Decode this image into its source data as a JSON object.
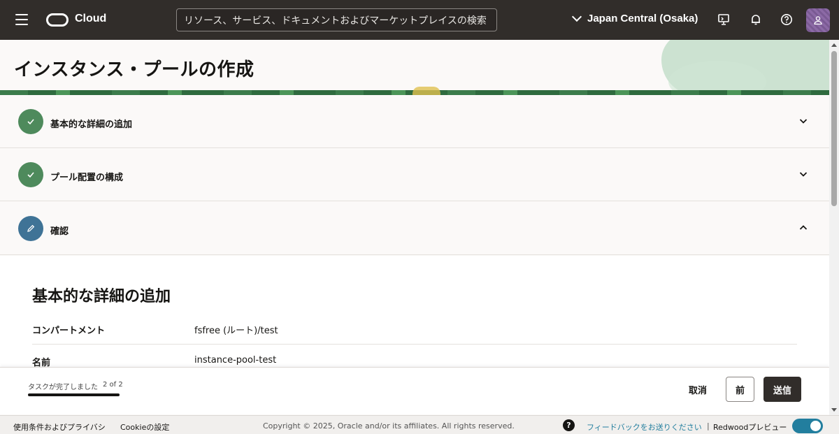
{
  "topbar": {
    "brand": "Cloud",
    "search_placeholder": "リソース、サービス、ドキュメントおよびマーケットプレイスの検索",
    "region": "Japan Central (Osaka)"
  },
  "page": {
    "title": "インスタンス・プールの作成"
  },
  "steps": [
    {
      "label": "基本的な詳細の追加",
      "state": "complete",
      "expanded": false
    },
    {
      "label": "プール配置の構成",
      "state": "complete",
      "expanded": false
    },
    {
      "label": "確認",
      "state": "editing",
      "expanded": true
    }
  ],
  "review": {
    "section_title": "基本的な詳細の追加",
    "rows": [
      {
        "label": "コンパートメント",
        "value": "fsfree (ルート)/test"
      },
      {
        "label": "名前",
        "value": "instance-pool-test"
      }
    ]
  },
  "actionbar": {
    "progress_text": "タスクが完了しました",
    "progress_count": "2 of 2",
    "progress_fraction": 1.0,
    "cancel_label": "取消",
    "prev_label": "前",
    "submit_label": "送信"
  },
  "footer": {
    "terms": "使用条件およびプライバシ",
    "cookie": "Cookieの設定",
    "copyright": "Copyright © 2025, Oracle and/or its affiliates. All rights reserved.",
    "help": "?",
    "feedback": "フィードバックをお送りください",
    "separator": "|",
    "redwood": "Redwoodプレビュー"
  },
  "colors": {
    "topbar": "#312d2a",
    "step_complete": "#4e8a5c",
    "step_editing": "#3f7396",
    "link": "#227e9e"
  }
}
